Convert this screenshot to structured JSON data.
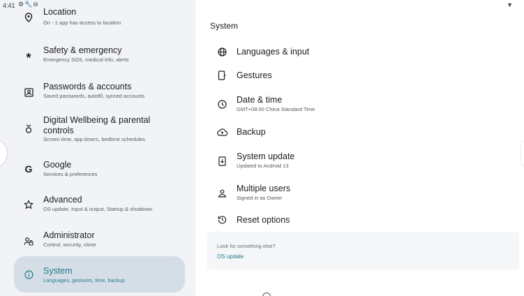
{
  "status_bar": {
    "time": "4:41",
    "icons": [
      "gear-icon",
      "wrench-icon",
      "circle-icon"
    ],
    "wifi_icon": "wifi-icon"
  },
  "left_menu": {
    "items": [
      {
        "icon": "location-pin-icon",
        "title": "Location",
        "subtitle": "On - 1 app has access to location"
      },
      {
        "icon": "asterisk-icon",
        "title": "Safety & emergency",
        "subtitle": "Emergency SOS, medical info, alerts"
      },
      {
        "icon": "account-box-icon",
        "title": "Passwords & accounts",
        "subtitle": "Saved passwords, autofill, synced accounts"
      },
      {
        "icon": "wellbeing-icon",
        "title_line1": "Digital Wellbeing & parental",
        "title_line2": "controls",
        "subtitle": "Screen time, app timers, bedtime schedules"
      },
      {
        "icon": "google-icon",
        "title": "Google",
        "subtitle": "Services & preferences"
      },
      {
        "icon": "star-outline-icon",
        "title": "Advanced",
        "subtitle": "OS update, Input & output, Startup & shutdown"
      },
      {
        "icon": "admin-icon",
        "title": "Administrator",
        "subtitle": "Control, security, clone"
      },
      {
        "icon": "info-icon",
        "title": "System",
        "subtitle": "Languages, gestures, time, backup",
        "selected": true
      }
    ]
  },
  "right_panel": {
    "header": "System",
    "items": [
      {
        "icon": "globe-icon",
        "title": "Languages & input"
      },
      {
        "icon": "gestures-icon",
        "title": "Gestures"
      },
      {
        "icon": "clock-icon",
        "title": "Date & time",
        "subtitle": "GMT+08:00 China Standard Time"
      },
      {
        "icon": "cloud-backup-icon",
        "title": "Backup"
      },
      {
        "icon": "system-update-icon",
        "title": "System update",
        "subtitle": "Updated to Android 13"
      },
      {
        "icon": "users-icon",
        "title": "Multiple users",
        "subtitle": "Signed in as Owner"
      },
      {
        "icon": "reset-icon",
        "title": "Reset options"
      }
    ],
    "suggestion": {
      "question": "Look for something else?",
      "link": "OS update"
    }
  },
  "colors": {
    "left_bg": "#f1f3f6",
    "selected_bg": "#d5dee6",
    "accent_teal": "#1f7a8c",
    "right_bg": "#ffffff"
  }
}
